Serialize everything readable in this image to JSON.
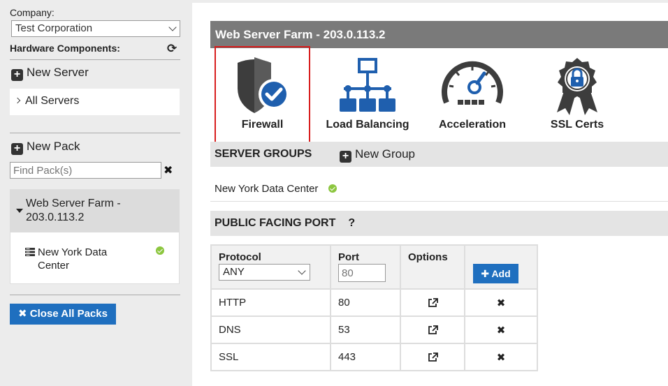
{
  "sidebar": {
    "company_label": "Company:",
    "company_value": "Test Corporation",
    "hardware_label": "Hardware Components:",
    "new_server_label": "New Server",
    "all_servers_label": "All Servers",
    "new_pack_label": "New Pack",
    "find_pack_placeholder": "Find Pack(s)",
    "pack": {
      "title": "Web Server Farm - 203.0.113.2",
      "item_label": "New York Data Center",
      "item_status": "ok"
    },
    "close_all_label": "Close All Packs"
  },
  "main": {
    "title": "Web Server Farm - 203.0.113.2",
    "tiles": [
      {
        "label": "Firewall",
        "icon": "shield-check-icon",
        "selected": true
      },
      {
        "label": "Load Balancing",
        "icon": "network-tree-icon",
        "selected": false
      },
      {
        "label": "Acceleration",
        "icon": "speedometer-icon",
        "selected": false
      },
      {
        "label": "SSL Certs",
        "icon": "certificate-lock-icon",
        "selected": false
      }
    ],
    "server_groups": {
      "heading": "SERVER GROUPS",
      "new_group_label": "New Group",
      "rows": [
        {
          "name": "New York Data Center",
          "status": "ok"
        }
      ]
    },
    "public_port": {
      "heading": "PUBLIC FACING PORT",
      "help": "?",
      "columns": [
        "Protocol",
        "Port",
        "Options",
        ""
      ],
      "protocol_value": "ANY",
      "port_placeholder": "80",
      "add_label": "Add",
      "rows": [
        {
          "protocol": "HTTP",
          "port": "80"
        },
        {
          "protocol": "DNS",
          "port": "53"
        },
        {
          "protocol": "SSL",
          "port": "443"
        }
      ]
    }
  },
  "colors": {
    "accent_blue": "#1f6fbf",
    "title_gray": "#7a7a7a",
    "status_green": "#8cc63f",
    "selection_red": "#d81e1e"
  }
}
